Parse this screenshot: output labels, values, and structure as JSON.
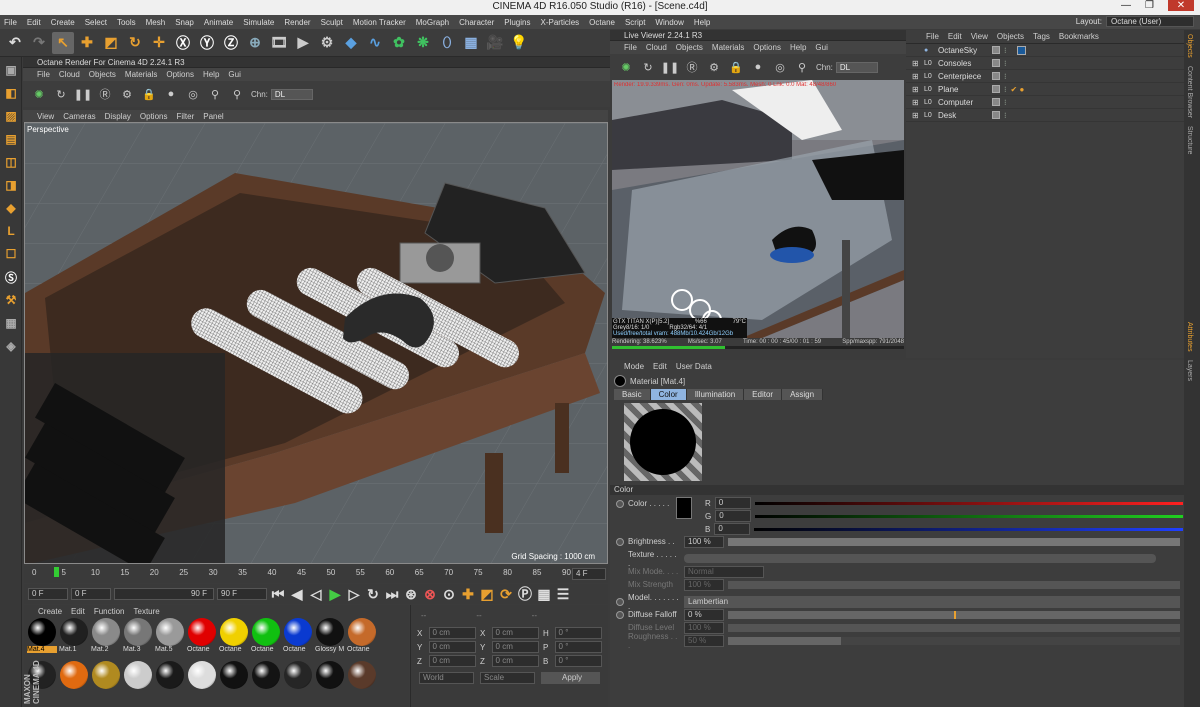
{
  "window": {
    "title": "CINEMA 4D R16.050 Studio (R16) - [Scene.c4d]",
    "min": "—",
    "max": "❐",
    "close": "✕"
  },
  "menubar": {
    "items": [
      "File",
      "Edit",
      "Create",
      "Select",
      "Tools",
      "Mesh",
      "Snap",
      "Animate",
      "Simulate",
      "Render",
      "Sculpt",
      "Motion Tracker",
      "MoGraph",
      "Character",
      "Plugins",
      "X-Particles",
      "Octane",
      "Script",
      "Window",
      "Help"
    ],
    "layout_label": "Layout:",
    "layout_value": "Octane (User)"
  },
  "octane_panel": {
    "title": "Octane Render For Cinema 4D 2.24.1 R3",
    "menu": [
      "File",
      "Cloud",
      "Objects",
      "Materials",
      "Options",
      "Help",
      "Gui"
    ],
    "chn_label": "Chn:",
    "chn_value": "DL"
  },
  "viewport": {
    "menu": [
      "View",
      "Cameras",
      "Display",
      "Options",
      "Filter",
      "Panel"
    ],
    "label": "Perspective",
    "grid_spacing": "Grid Spacing : 1000 cm"
  },
  "timeline": {
    "ticks": [
      "0",
      "5",
      "10",
      "15",
      "20",
      "25",
      "30",
      "35",
      "40",
      "45",
      "50",
      "55",
      "60",
      "65",
      "70",
      "75",
      "80",
      "85",
      "90"
    ],
    "current_frame": "4 F",
    "start_frame": "0 F",
    "min_frame": "0 F",
    "end_frame": "90 F",
    "max_frame": "90 F"
  },
  "material_manager": {
    "menu": [
      "Create",
      "Edit",
      "Function",
      "Texture"
    ],
    "row1": [
      {
        "label": "Mat.4",
        "color": "#000000",
        "selected": true
      },
      {
        "label": "Mat.1",
        "color": "#202020"
      },
      {
        "label": "Mat.2",
        "color": "#8a8a8a"
      },
      {
        "label": "Mat.3",
        "color": "#777777"
      },
      {
        "label": "Mat.5",
        "color": "#9a9a9a"
      },
      {
        "label": "Octane",
        "color": "#e00000"
      },
      {
        "label": "Octane",
        "color": "#f0d000"
      },
      {
        "label": "Octane",
        "color": "#10c010"
      },
      {
        "label": "Octane",
        "color": "#0a3ad0"
      },
      {
        "label": "Glossy M",
        "color": "#111111"
      },
      {
        "label": "Octane",
        "color": "#c56a2a"
      }
    ],
    "row2": [
      "#222222",
      "#e06a10",
      "#b08a20",
      "#cccccc",
      "#1a1a1a",
      "#dddddd",
      "#111111",
      "#141414",
      "#262626",
      "#111111",
      "#5a3a2a"
    ],
    "brand": "MAXON CINEMA 4D"
  },
  "coords": {
    "header": [
      "--",
      "--",
      "--"
    ],
    "rows": [
      {
        "a": "X",
        "av": "0 cm",
        "b": "X",
        "bv": "0 cm",
        "c": "H",
        "cv": "0 °"
      },
      {
        "a": "Y",
        "av": "0 cm",
        "b": "Y",
        "bv": "0 cm",
        "c": "P",
        "cv": "0 °"
      },
      {
        "a": "Z",
        "av": "0 cm",
        "b": "Z",
        "bv": "0 cm",
        "c": "B",
        "cv": "0 °"
      }
    ],
    "mode1": "World",
    "mode2": "Scale",
    "apply": "Apply"
  },
  "live_viewer": {
    "title": "Live Viewer 2.24.1 R3",
    "menu": [
      "File",
      "Cloud",
      "Objects",
      "Materials",
      "Options",
      "Help",
      "Gui"
    ],
    "chn_label": "Chn:",
    "chn_value": "DL",
    "status_top": "Render: 19.9.339ms. Gen: 0ms. Update: 5.583ms. Mesh: 0 Lnk: 0.0 Mat: 48/48/860",
    "gpu_name": "GTX TITAN X(P)[5.2]",
    "gpu_usage": "%66",
    "gpu_temp": "79°C",
    "grey": "Grey8/16: 1/0",
    "rgb": "Rgb32/64: 4/1",
    "vram": "Used/free/total vram: 488Mb/10.424Gb/12Gb",
    "rendering": "Rendering: 38.623%",
    "ms": "Ms/sec: 3.07",
    "time": "Time: 00 : 00 : 45/00 : 01 : 59",
    "spp": "Spp/maxspp: 791/2048",
    "progress": 0.386
  },
  "object_manager": {
    "menu": [
      "File",
      "Edit",
      "View",
      "Objects",
      "Tags",
      "Bookmarks"
    ],
    "objects": [
      "OctaneSky",
      "Consoles",
      "Centerpiece",
      "Plane",
      "Computer",
      "Desk"
    ]
  },
  "attributes": {
    "menu": [
      "Mode",
      "Edit",
      "User Data"
    ],
    "material_name": "Material [Mat.4]",
    "tabs": [
      "Basic",
      "Color",
      "Illumination",
      "Editor",
      "Assign"
    ],
    "active_tab": "Color",
    "section": "Color",
    "color_label": "Color . . . . .",
    "r_label": "R",
    "r_value": "0",
    "g_label": "G",
    "g_value": "0",
    "b_label": "B",
    "b_value": "0",
    "brightness_label": "Brightness . .",
    "brightness_value": "100 %",
    "texture_label": "Texture . . . . . .",
    "mix_mode_label": "Mix Mode. . . .",
    "mix_mode_value": "Normal",
    "mix_strength_label": "Mix Strength",
    "mix_strength_value": "100 %",
    "model_label": "Model. . . . . . . .",
    "model_value": "Lambertian",
    "diffuse_falloff_label": "Diffuse Falloff",
    "diffuse_falloff_value": "0 %",
    "diffuse_level_label": "Diffuse Level",
    "diffuse_level_value": "100 %",
    "roughness_label": "Roughness . . .",
    "roughness_value": "50 %"
  },
  "side_tabs": [
    "Objects",
    "Content Browser",
    "Structure",
    "Attributes",
    "Layers"
  ]
}
